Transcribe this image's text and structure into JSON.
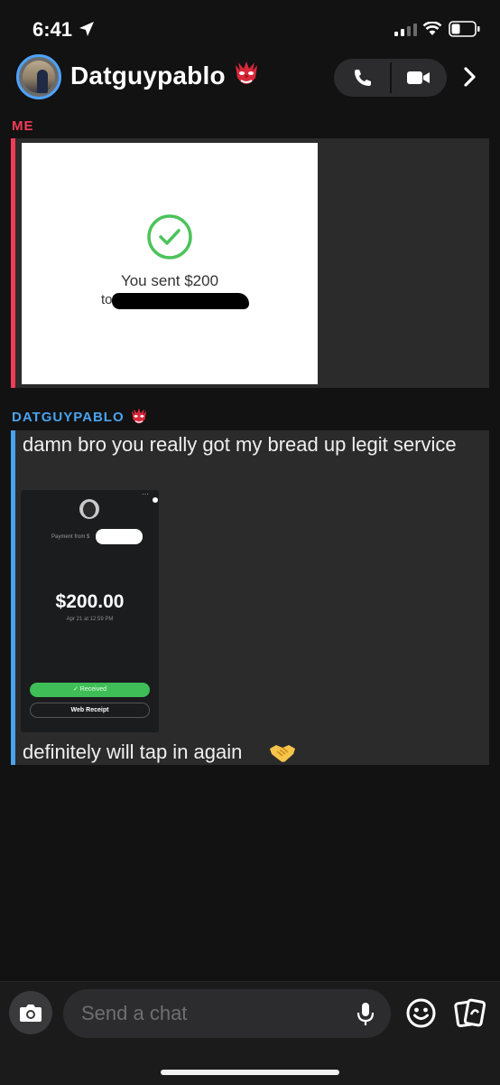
{
  "status_bar": {
    "time": "6:41"
  },
  "header": {
    "contact_name": "Datguypablo"
  },
  "thread": {
    "me_label": "ME",
    "me_receipt": {
      "sent_text": "You sent $200",
      "to_prefix": "to"
    },
    "them_label": "DATGUYPABLO",
    "them_message_1": "damn bro you really got my bread up legit service",
    "payment_screenshot": {
      "from_text": "Payment from $",
      "amount": "$200.00",
      "date": "Apr 21 at 12:59 PM",
      "status": "✓  Received",
      "receipt_button": "Web Receipt",
      "menu": "···"
    },
    "them_message_2": "definitely will tap in again"
  },
  "composer": {
    "placeholder": "Send a chat"
  },
  "colors": {
    "me_accent": "#f23c57",
    "them_accent": "#4aa3ee",
    "background": "#121212",
    "bubble": "#2b2b2b",
    "success": "#3fbe57"
  },
  "icons": [
    "location-arrow-icon",
    "signal-icon",
    "wifi-icon",
    "battery-icon",
    "goblin-emoji-icon",
    "phone-icon",
    "video-icon",
    "chevron-right-icon",
    "check-circle-icon",
    "handshake-icon",
    "camera-icon",
    "mic-icon",
    "smiley-icon",
    "cards-icon"
  ]
}
